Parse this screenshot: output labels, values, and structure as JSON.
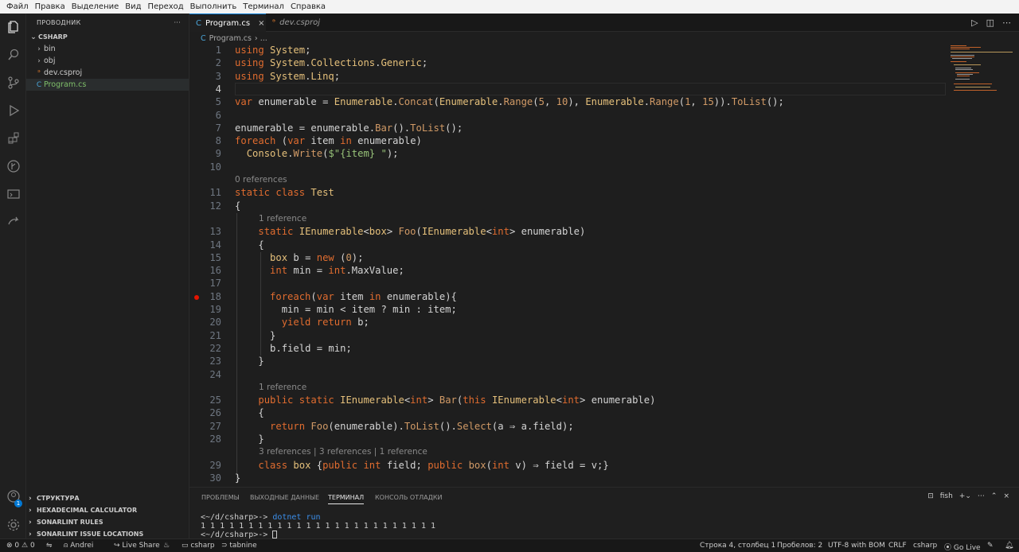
{
  "menu": [
    "Файл",
    "Правка",
    "Выделение",
    "Вид",
    "Переход",
    "Выполнить",
    "Терминал",
    "Справка"
  ],
  "sidebar": {
    "title": "ПРОВОДНИК",
    "more": "···",
    "root": "CSHARP",
    "items": [
      {
        "label": "bin",
        "type": "folder"
      },
      {
        "label": "obj",
        "type": "folder"
      },
      {
        "label": "dev.csproj",
        "type": "rss"
      },
      {
        "label": "Program.cs",
        "type": "cs",
        "selected": true
      }
    ],
    "sections": [
      "СТРУКТУРА",
      "HEXADECIMAL CALCULATOR",
      "SONARLINT RULES",
      "SONARLINT ISSUE LOCATIONS"
    ],
    "account_badge": "1"
  },
  "tabs": [
    {
      "label": "Program.cs",
      "active": true
    },
    {
      "label": "dev.csproj",
      "active": false
    }
  ],
  "breadcrumb": {
    "file": "Program.cs",
    "sep": "› ..."
  },
  "code": {
    "lines": [
      {
        "n": "1",
        "html": "<span class='k'>using</span> <span class='t'>System</span>;"
      },
      {
        "n": "2",
        "html": "<span class='k'>using</span> <span class='t'>System</span>.<span class='t'>Collections</span>.<span class='t'>Generic</span>;"
      },
      {
        "n": "3",
        "html": "<span class='k'>using</span> <span class='t'>System</span>.<span class='t'>Linq</span>;"
      },
      {
        "n": "4",
        "html": ""
      },
      {
        "n": "5",
        "html": "<span class='k'>var</span> <span class='v'>enumerable</span> = <span class='t'>Enumerable</span>.<span class='f'>Concat</span>(<span class='t'>Enumerable</span>.<span class='f'>Range</span>(<span class='n'>5</span>, <span class='n'>10</span>), <span class='t'>Enumerable</span>.<span class='f'>Range</span>(<span class='n'>1</span>, <span class='n'>15</span>)).<span class='f'>ToList</span>();"
      },
      {
        "n": "6",
        "html": ""
      },
      {
        "n": "7",
        "html": "<span class='v'>enumerable</span> = <span class='v'>enumerable</span>.<span class='f'>Bar</span>().<span class='f'>ToList</span>();"
      },
      {
        "n": "8",
        "html": "<span class='k'>foreach</span> (<span class='k'>var</span> <span class='v'>item</span> <span class='k'>in</span> <span class='v'>enumerable</span>)"
      },
      {
        "n": "9",
        "html": "  <span class='t'>Console</span>.<span class='f'>Write</span>(<span class='s'>$\"{item} \"</span>);"
      },
      {
        "n": "10",
        "html": ""
      },
      {
        "n": "11",
        "html": "<span class='k'>static</span> <span class='k'>class</span> <span class='t'>Test</span>"
      },
      {
        "n": "12",
        "html": "{"
      },
      {
        "n": "13",
        "html": "    <span class='k'>static</span> <span class='t'>IEnumerable</span>&lt;<span class='t'>box</span>&gt; <span class='f'>Foo</span>(<span class='t'>IEnumerable</span>&lt;<span class='k'>int</span>&gt; <span class='v'>enumerable</span>)"
      },
      {
        "n": "14",
        "html": "    {"
      },
      {
        "n": "15",
        "html": "      <span class='t'>box</span> <span class='v'>b</span> = <span class='k'>new</span> (<span class='n'>0</span>);"
      },
      {
        "n": "16",
        "html": "      <span class='k'>int</span> <span class='v'>min</span> = <span class='k'>int</span>.<span class='v'>MaxValue</span>;"
      },
      {
        "n": "17",
        "html": ""
      },
      {
        "n": "18",
        "html": "      <span class='k'>foreach</span>(<span class='k'>var</span> <span class='v'>item</span> <span class='k'>in</span> <span class='v'>enumerable</span>){"
      },
      {
        "n": "19",
        "html": "        <span class='v'>min</span> = <span class='v'>min</span> &lt; <span class='v'>item</span> ? <span class='v'>min</span> : <span class='v'>item</span>;"
      },
      {
        "n": "20",
        "html": "        <span class='k'>yield</span> <span class='k'>return</span> <span class='v'>b</span>;"
      },
      {
        "n": "21",
        "html": "      }"
      },
      {
        "n": "22",
        "html": "      <span class='v'>b</span>.<span class='v'>field</span> = <span class='v'>min</span>;"
      },
      {
        "n": "23",
        "html": "    }"
      },
      {
        "n": "24",
        "html": ""
      },
      {
        "n": "25",
        "html": "    <span class='k'>public</span> <span class='k'>static</span> <span class='t'>IEnumerable</span>&lt;<span class='k'>int</span>&gt; <span class='f'>Bar</span>(<span class='k'>this</span> <span class='t'>IEnumerable</span>&lt;<span class='k'>int</span>&gt; <span class='v'>enumerable</span>)"
      },
      {
        "n": "26",
        "html": "    {"
      },
      {
        "n": "27",
        "html": "      <span class='k'>return</span> <span class='f'>Foo</span>(<span class='v'>enumerable</span>).<span class='f'>ToList</span>().<span class='f'>Select</span>(<span class='v'>a</span> ⇒ <span class='v'>a</span>.<span class='v'>field</span>);"
      },
      {
        "n": "28",
        "html": "    }"
      },
      {
        "n": "29",
        "html": "    <span class='k'>class</span> <span class='t'>box</span> {<span class='k'>public</span> <span class='k'>int</span> <span class='v'>field</span>; <span class='k'>public</span> <span class='f'>box</span>(<span class='k'>int</span> <span class='v'>v</span>) ⇒ <span class='v'>field</span> = <span class='v'>v</span>;}"
      },
      {
        "n": "30",
        "html": "}"
      }
    ],
    "lens": {
      "before_11": "0 references",
      "before_13": "1 reference",
      "before_25": "1 reference",
      "before_29": "3 references | 3 references | 1 reference"
    }
  },
  "panel": {
    "tabs": [
      "ПРОБЛЕМЫ",
      "ВЫХОДНЫЕ ДАННЫЕ",
      "ТЕРМИНАЛ",
      "КОНСОЛЬ ОТЛАДКИ"
    ],
    "active_tab": "ТЕРМИНАЛ",
    "shell": "fish",
    "terminal": [
      {
        "prompt": "<~/d/csharp>-> ",
        "cmd": "dotnet run"
      },
      {
        "out": "1 1 1 1 1 1 1 1 1 1 1 1 1 1 1 1 1 1 1 1 1 1 1 1 1"
      },
      {
        "prompt": "<~/d/csharp>-> ",
        "cmd": ""
      }
    ]
  },
  "status": {
    "errors": "0",
    "warnings": "0",
    "user": "Andrei",
    "liveshare": "Live Share",
    "folder": "csharp",
    "tabnine": "tabnine",
    "position": "Строка 4, столбец 1",
    "spaces": "Пробелов: 2",
    "encoding": "UTF-8 with BOM",
    "eol": "CRLF",
    "lang": "csharp",
    "golive": "Go Live"
  },
  "colors": {
    "accent": "#0078d4",
    "breakpoint": "#e51400",
    "keyword": "#e06c2f",
    "type": "#e5c07b",
    "string": "#98c379"
  }
}
